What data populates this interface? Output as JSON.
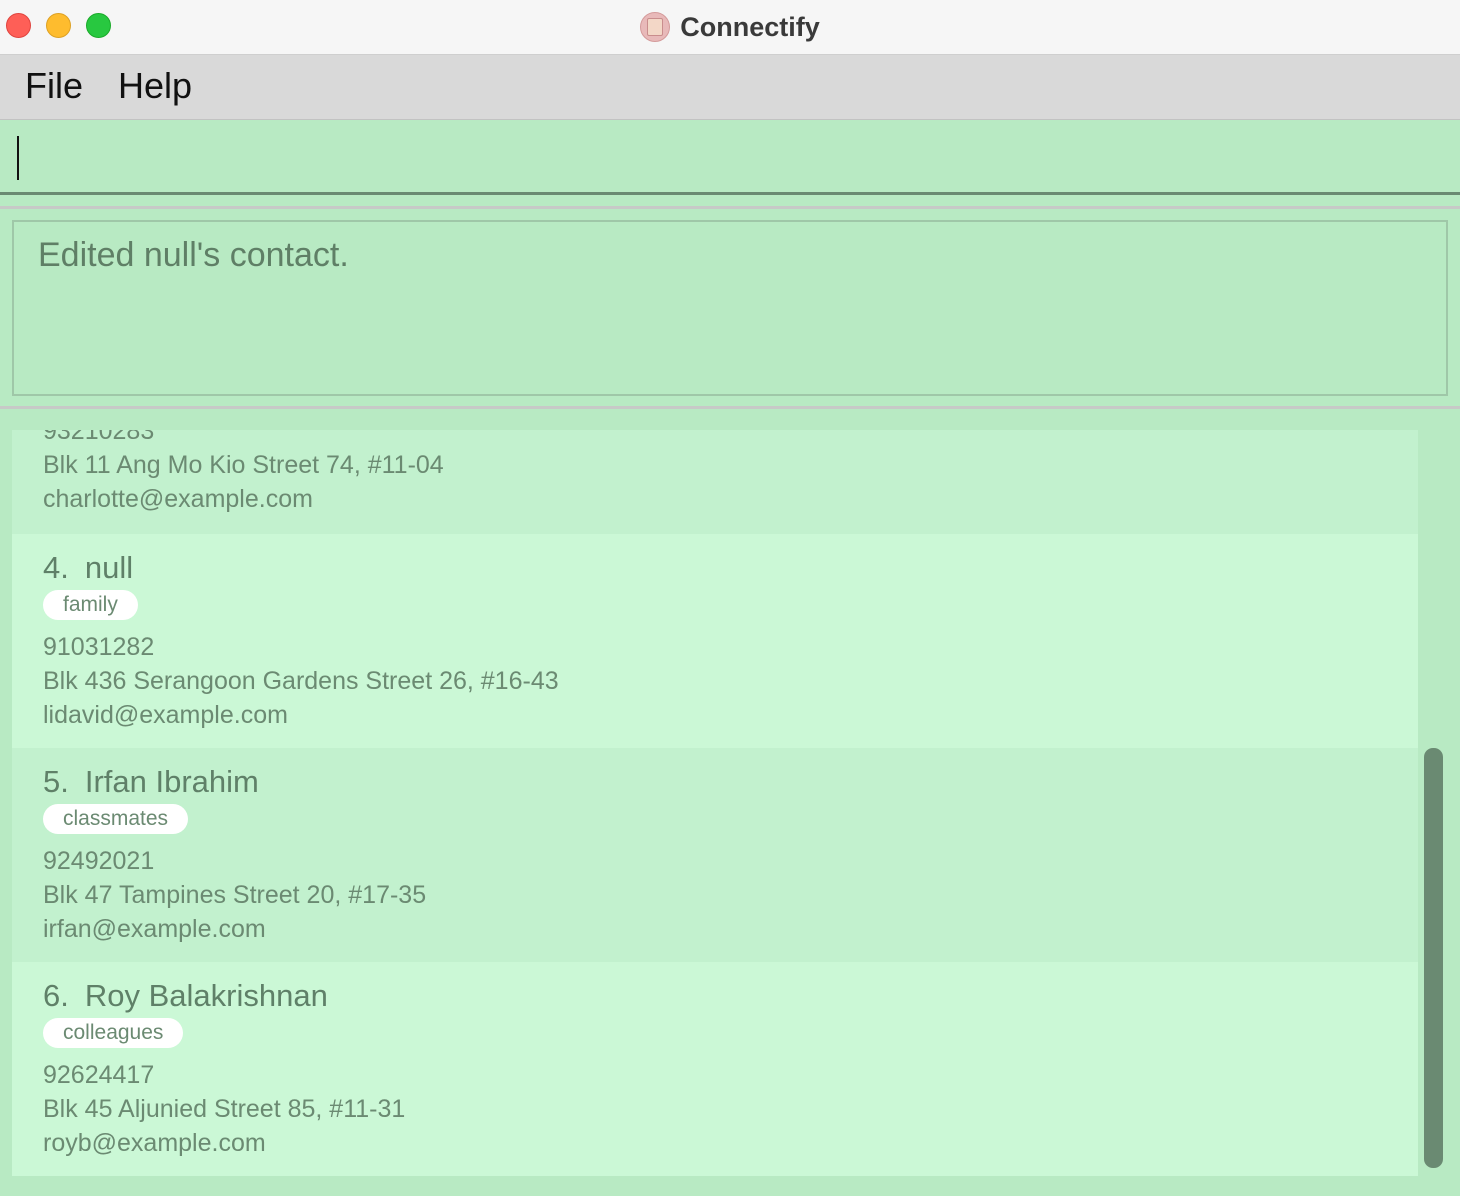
{
  "window": {
    "title": "Connectify"
  },
  "menu": {
    "file": "File",
    "help": "Help"
  },
  "command": {
    "value": ""
  },
  "result": {
    "message": "Edited null's contact."
  },
  "persons": {
    "p3": {
      "phone_partial": "93210283",
      "address": "Blk 11 Ang Mo Kio Street 74, #11-04",
      "email": "charlotte@example.com"
    },
    "p4": {
      "index": "4.",
      "name": "null",
      "tag": "family",
      "phone": "91031282",
      "address": "Blk 436 Serangoon Gardens Street 26, #16-43",
      "email": "lidavid@example.com"
    },
    "p5": {
      "index": "5.",
      "name": "Irfan Ibrahim",
      "tag": "classmates",
      "phone": "92492021",
      "address": "Blk 47 Tampines Street 20, #17-35",
      "email": "irfan@example.com"
    },
    "p6": {
      "index": "6.",
      "name": "Roy Balakrishnan",
      "tag": "colleagues",
      "phone": "92624417",
      "address": "Blk 45 Aljunied Street 85, #11-31",
      "email": "royb@example.com"
    }
  }
}
